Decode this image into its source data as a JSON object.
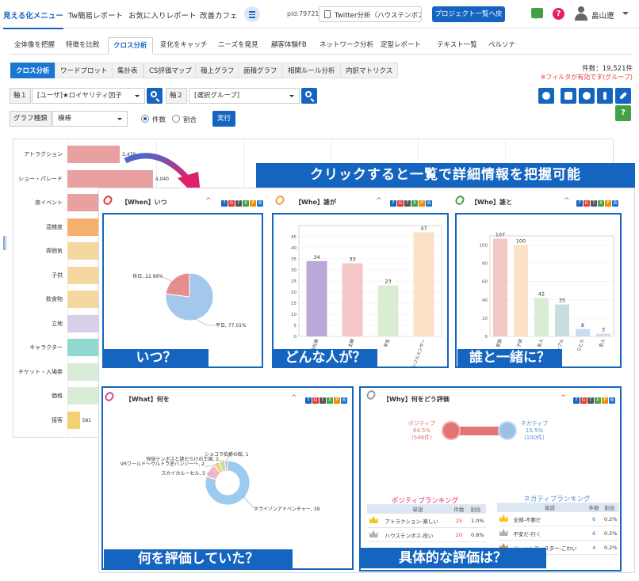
{
  "nav": {
    "brand": "見える化メニュー",
    "links": [
      "Tw簡易レポート",
      "お気に入りレポート",
      "改善カフェ"
    ],
    "pid": "pid:79721",
    "project": "Twitter分析（ハウステンボス）",
    "project_button": "プロジェクト一覧へ戻る",
    "help_label": "?",
    "user": "畠山遼"
  },
  "tabs": [
    "全体像を把握",
    "特徴を比較",
    "クロス分析",
    "変化をキャッチ",
    "ニーズを発見",
    "顧客体験FB",
    "ネットワーク分析",
    "定型レポート",
    "テキスト一覧",
    "ペルソナ"
  ],
  "subtabs": [
    "クロス分析",
    "ワードプロット",
    "集計表",
    "CS評価マップ",
    "積上グラフ",
    "面積グラフ",
    "相関ルール分析",
    "内訳マトリクス"
  ],
  "status": {
    "count": "件数：19,521件",
    "filter": "※フィルタが有効です(グループ)"
  },
  "controls": {
    "axis1_label": "軸１",
    "axis1_value": "[ユーザ]★ロイヤリティ因子",
    "axis2_label": "軸２",
    "axis2_value": "[選択グループ]",
    "graph_label": "グラフ種類",
    "graph_value": "横棒",
    "radio1": "件数",
    "radio2": "割合",
    "run": "実行",
    "green_btn": "?"
  },
  "bg_chart": {
    "categories": [
      "アトラクション",
      "ショー・パレード",
      "夜イベント",
      "混雑度",
      "雰囲気",
      "子供",
      "飲食物",
      "立地",
      "キャラクター",
      "チケット・入場券",
      "価格",
      "接客"
    ],
    "values": [
      2479,
      4040,
      null,
      null,
      null,
      null,
      null,
      null,
      null,
      null,
      null,
      581
    ],
    "value_labels": [
      "2,479",
      "4,040",
      "",
      "",
      "",
      "",
      "",
      "",
      "",
      "",
      "",
      "581"
    ],
    "colors": [
      "#e8a0a0",
      "#e8a0a0",
      "#e8a0a0",
      "#f5b070",
      "#f5d8a0",
      "#f5d8a0",
      "#f5d8a0",
      "#d8d0e8",
      "#90d8d0",
      "#d8ecd8",
      "#d8ecd8",
      "#f5d070"
    ]
  },
  "banner": "クリックすると一覧で詳細情報を把握可能",
  "icon_letters": [
    "f",
    "G",
    "T",
    "X",
    "P",
    "B"
  ],
  "when": {
    "title": "【When】いつ",
    "caption": "いつ？",
    "chart_data": {
      "type": "pie",
      "slices": [
        {
          "name": "平日",
          "value": 77.01,
          "label": "平日, 77.01%",
          "color": "#a3c8ec"
        },
        {
          "name": "休日",
          "value": 22.99,
          "label": "休日, 22.99%",
          "color": "#e88d8d"
        }
      ]
    }
  },
  "who": {
    "title": "【Who】誰が",
    "caption": "どんな人が？",
    "chart_data": {
      "type": "bar",
      "categories": [
        "会社員",
        "主婦",
        "学生",
        "インフルエンサー"
      ],
      "values": [
        34,
        33,
        23,
        47
      ],
      "ylim": [
        0,
        50
      ],
      "yticks": [
        0,
        5,
        10,
        15,
        20,
        25,
        30,
        35,
        40,
        45
      ],
      "colors": [
        "#b9a8d8",
        "#f4c6c6",
        "#d9ecd4",
        "#fbe1c7"
      ]
    }
  },
  "with": {
    "title": "【Who】誰と",
    "caption": "誰と一緒に？",
    "chart_data": {
      "type": "bar",
      "categories": [
        "家族",
        "子供",
        "友人",
        "カップル",
        "ひとり",
        "恋人"
      ],
      "values": [
        107,
        100,
        42,
        35,
        8,
        3
      ],
      "ylim": [
        0,
        110
      ],
      "yticks": [
        0,
        20,
        40,
        60,
        80,
        100
      ],
      "colors": [
        "#f4c6c6",
        "#fbe1c7",
        "#d9ecd4",
        "#c8dede",
        "#c8dcf4",
        "#ded4ec"
      ]
    }
  },
  "what": {
    "title": "【What】何を",
    "caption": "何を評価していた？",
    "chart_data": {
      "type": "pie",
      "slices": [
        {
          "name": "ホライゾンアドベンチャー",
          "value": 39,
          "label": "ホライゾンアドベンチャー, 39",
          "color": "#9ccbf0"
        },
        {
          "name": "スカイカルーセル",
          "value": 5,
          "label": "スカイカルーセル, 5",
          "color": "#f5b5c8"
        },
        {
          "name": "VRワールド〜ウルトラ逆バンジー〜",
          "value": 2,
          "label": "VRワールド〜ウルトラ逆バンジー〜, 2",
          "color": "#f8d070"
        },
        {
          "name": "探偵テンボスと謎だらけの王国",
          "value": 2,
          "label": "探偵テンボスと謎だらけの王国, 2",
          "color": "#b8e0a0"
        },
        {
          "name": "ショコラ伯爵の館",
          "value": 1,
          "label": "ショコラ伯爵の館, 1",
          "color": "#c8b0e0"
        }
      ]
    }
  },
  "why": {
    "title": "【Why】何をどう評価",
    "caption": "具体的な評価は？",
    "positive": {
      "label": "ポジティブ",
      "percent": "84.5%",
      "count": "(546件)",
      "value": 84.5
    },
    "negative": {
      "label": "ネガティブ",
      "percent": "15.5%",
      "count": "(100件)",
      "value": 15.5
    },
    "pos_rank_title": "ポジティブランキング",
    "neg_rank_title": "ネガティブランキング",
    "columns": [
      "単語",
      "件数",
      "割合"
    ],
    "pos_rows": [
      {
        "word": "アトラクション-楽しい",
        "count": "25",
        "ratio": "1.0%"
      },
      {
        "word": "ハウステンボス-良い",
        "count": "20",
        "ratio": "0.8%"
      }
    ],
    "neg_rows": [
      {
        "word": "全部-不要だ",
        "count": "6",
        "ratio": "0.2%"
      },
      {
        "word": "不安だ-行く",
        "count": "6",
        "ratio": "0.2%"
      },
      {
        "word": "ジェットコースター-こわい",
        "count": "4",
        "ratio": "0.2%"
      }
    ]
  }
}
